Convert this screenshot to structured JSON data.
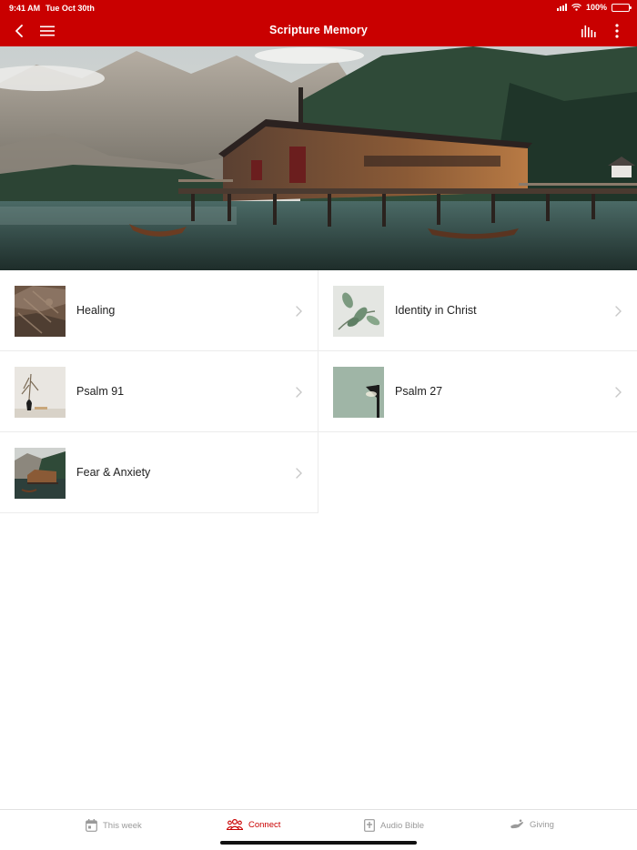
{
  "status_bar": {
    "time": "9:41 AM",
    "date": "Tue Oct 30th",
    "battery": "100%"
  },
  "header": {
    "title": "Scripture Memory",
    "icons": [
      "back-arrow-icon",
      "hamburger-menu-icon",
      "audio-bars-icon",
      "more-vertical-icon"
    ]
  },
  "hero": {
    "icon": "mountain-lake-boathouse-image"
  },
  "topics": [
    {
      "label": "Healing",
      "thumb": "rocky-texture-image"
    },
    {
      "label": "Identity in Christ",
      "thumb": "plant-leaves-image"
    },
    {
      "label": "Psalm 91",
      "thumb": "vase-dried-plant-image"
    },
    {
      "label": "Psalm 27",
      "thumb": "lamp-on-wall-image"
    },
    {
      "label": "Fear & Anxiety",
      "thumb": "boathouse-lake-image"
    }
  ],
  "tabbar": {
    "tabs": [
      {
        "label": "This week",
        "icon": "calendar-icon",
        "active": false
      },
      {
        "label": "Connect",
        "icon": "people-group-icon",
        "active": true
      },
      {
        "label": "Audio Bible",
        "icon": "bible-plus-icon",
        "active": false
      },
      {
        "label": "Giving",
        "icon": "hand-giving-icon",
        "active": false
      }
    ]
  },
  "colors": {
    "brand": "#c90000",
    "inactive_tab": "#9a9a9a",
    "divider": "#ececec"
  }
}
